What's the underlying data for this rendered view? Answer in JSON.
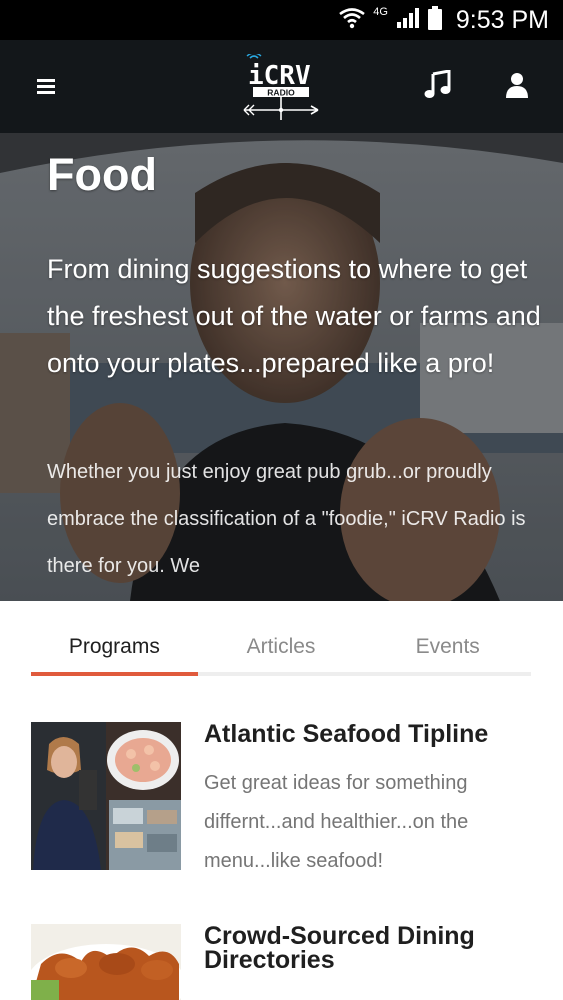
{
  "status_bar": {
    "network": "4G",
    "time": "9:53 PM",
    "icons": [
      "wifi-icon",
      "signal-icon",
      "battery-icon"
    ]
  },
  "header": {
    "logo_text": "iCRV",
    "logo_subtext": "RADIO",
    "menu_icon": "hamburger-menu-icon",
    "music_icon": "music-note-icon",
    "user_icon": "user-icon"
  },
  "hero": {
    "title": "Food",
    "subtitle": "From dining suggestions to where to get the freshest out of the water or farms and onto your plates...prepared like a pro!",
    "body": "Whether you just enjoy great pub grub...or proudly embrace the classification of a \"foodie,\" iCRV Radio is there for you.  We"
  },
  "tabs": [
    {
      "label": "Programs",
      "active": true
    },
    {
      "label": "Articles",
      "active": false
    },
    {
      "label": "Events",
      "active": false
    }
  ],
  "programs": [
    {
      "title": "Atlantic Seafood Tipline",
      "description": "Get great ideas for something differnt...and healthier...on the menu...like seafood!"
    },
    {
      "title": "Crowd-Sourced Dining Directories",
      "description": ""
    }
  ],
  "colors": {
    "header_bg": "#13171a",
    "tab_accent": "#e05a3c",
    "status_bar_bg": "#000000"
  }
}
